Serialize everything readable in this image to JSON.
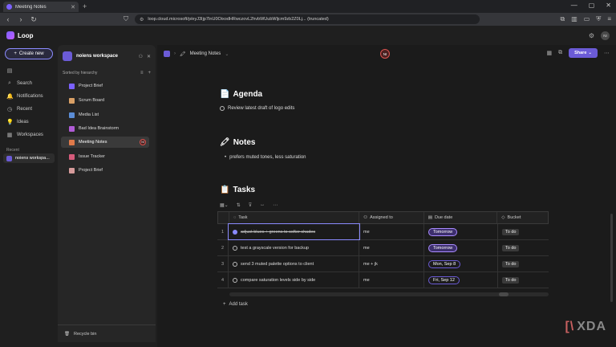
{
  "browser": {
    "tab_title": "Meeting Notes",
    "tab_close": "✕",
    "new_tab": "+",
    "url": "loop.cloud.microsoft/p/eyJ3Ijp7InU0OixodHRwczovL2hvbWUubWljcm9zb2Z0Lj... (truncated)",
    "window_controls": [
      "—",
      "▢",
      "✕"
    ]
  },
  "app": {
    "name": "Loop",
    "user_initials": "NI"
  },
  "rail": {
    "create_label": "Create new",
    "items": [
      {
        "label": "Search",
        "icon": "⌕"
      },
      {
        "label": "Notifications",
        "icon": "🔔"
      },
      {
        "label": "Recent",
        "icon": "◷"
      },
      {
        "label": "Ideas",
        "icon": "💡"
      },
      {
        "label": "Workspaces",
        "icon": "▦"
      }
    ],
    "recent_label": "Recent",
    "recent_item": "noiens workspa..."
  },
  "workspace": {
    "title": "noiens workspace",
    "sort_label": "Sorted by hierarchy",
    "pages": [
      {
        "label": "Project Brief",
        "color": "#7b61ff"
      },
      {
        "label": "Scrum Board",
        "color": "#d9a066"
      },
      {
        "label": "Media List",
        "color": "#5b8dd6"
      },
      {
        "label": "Bad Idea Brainstorm",
        "color": "#b05bd6"
      },
      {
        "label": "Meeting Notes",
        "color": "#e07a4a",
        "active": true,
        "badge": "NI"
      },
      {
        "label": "Issue Tracker",
        "color": "#d65b7b"
      },
      {
        "label": "Project Brief",
        "color": "#d69b9b"
      }
    ],
    "footer": "Recycle bin"
  },
  "main": {
    "breadcrumb": "Meeting Notes",
    "collab_initials": "NI",
    "share_label": "Share",
    "agenda": {
      "emoji": "📄",
      "title": "Agenda",
      "item": "Review latest draft of logo edits"
    },
    "notes": {
      "emoji": "🖍",
      "title": "Notes",
      "item": "prefers muted tones, less saturation"
    },
    "tasks": {
      "emoji": "📋",
      "title": "Tasks",
      "columns": [
        "Task",
        "Assigned to",
        "Due date",
        "Bucket"
      ],
      "rows": [
        {
          "num": "1",
          "task": "adjust blues + greens to softer shades",
          "assigned": "me",
          "due": "Tomorrow",
          "bucket": "To do",
          "done": true
        },
        {
          "num": "2",
          "task": "test a grayscale version for backup",
          "assigned": "me",
          "due": "Tomorrow",
          "bucket": "To do",
          "done": false
        },
        {
          "num": "3",
          "task": "send 3 muted palette options to client",
          "assigned": "me + jk",
          "due": "Mon, Sep 8",
          "bucket": "To do",
          "done": false
        },
        {
          "num": "4",
          "task": "compare saturation levels side by side",
          "assigned": "me",
          "due": "Fri, Sep 12",
          "bucket": "To do",
          "done": false
        }
      ],
      "add_label": "Add task"
    }
  },
  "watermark": "XDA"
}
